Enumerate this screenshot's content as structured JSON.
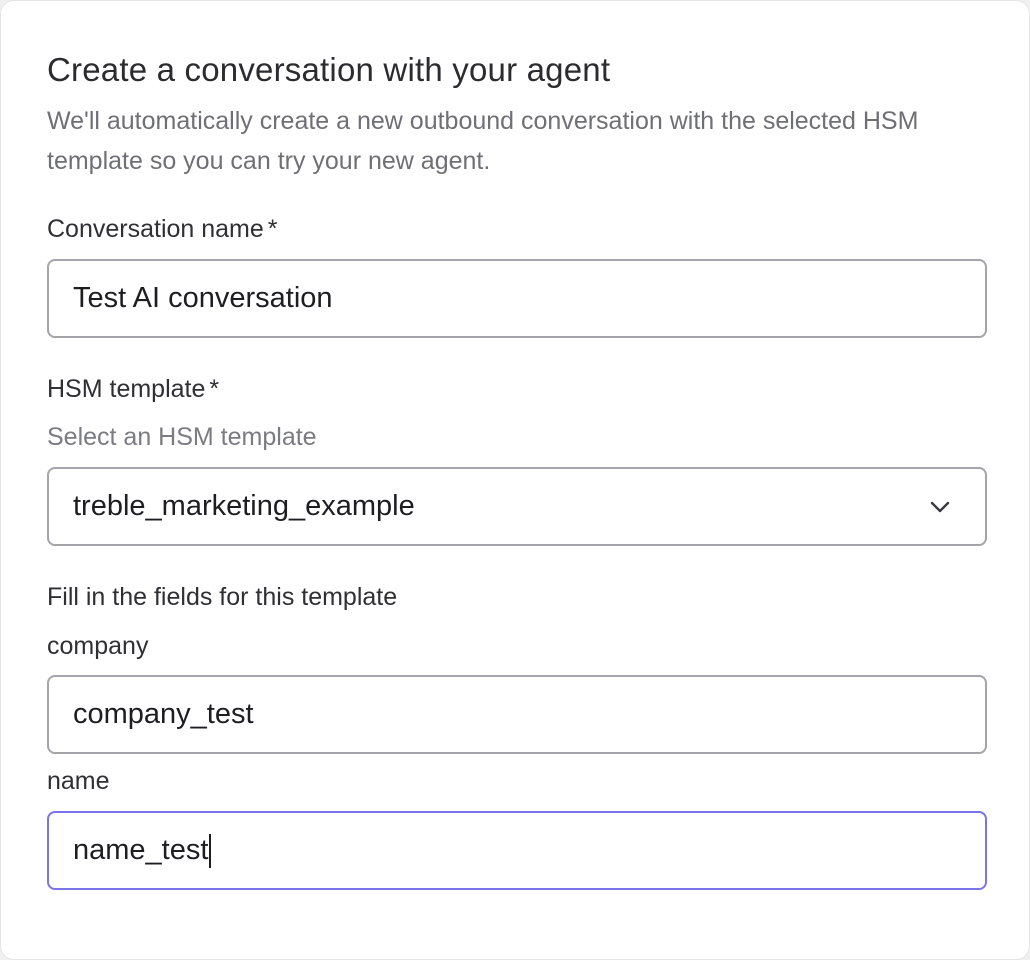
{
  "dialog": {
    "title": "Create a conversation with your agent",
    "description": "We'll automatically create a new outbound conversation with the selected HSM template so you can try your new agent."
  },
  "conversation_name": {
    "label": "Conversation name",
    "required_marker": "*",
    "value": "Test AI conversation"
  },
  "hsm_template": {
    "label": "HSM template",
    "required_marker": "*",
    "hint": "Select an HSM template",
    "selected": "treble_marketing_example",
    "icon": "chevron-down-icon"
  },
  "template_fields": {
    "heading": "Fill in the fields for this template",
    "company": {
      "label": "company",
      "value": "company_test"
    },
    "name": {
      "label": "name",
      "value": "name_test"
    }
  },
  "colors": {
    "focus_border": "#7b73e8",
    "input_border": "#a4a4a9",
    "text_primary": "#2f2f34",
    "text_muted": "#6f6f76"
  }
}
